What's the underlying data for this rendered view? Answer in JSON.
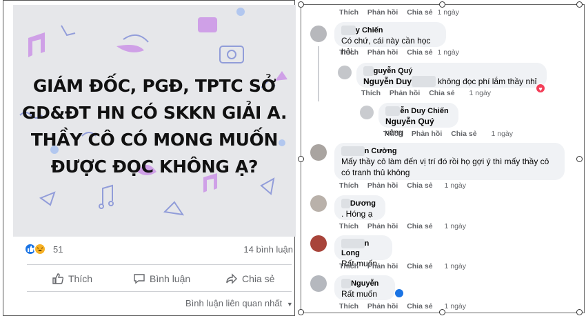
{
  "post": {
    "image_text": [
      "GIÁM ĐỐC, PGĐ, TPTC SỞ",
      "GD&ĐT HN CÓ SKKN GIẢI A.",
      "THẦY CÔ CÓ MONG MUỐN",
      "ĐƯỢC ĐỌC KHÔNG Ạ?"
    ],
    "reaction_count": "51",
    "comment_count": "14 bình luận",
    "actions": {
      "like": "Thích",
      "comment": "Bình luận",
      "share": "Chia sẻ"
    },
    "comment_sort": "Bình luận liên quan nhất"
  },
  "comments": {
    "meta_labels": {
      "like": "Thích",
      "reply": "Phản hồi",
      "share": "Chia sẻ"
    },
    "items": [
      {
        "author": "",
        "text": "",
        "time": "1 ngày"
      },
      {
        "author": "y Chiến",
        "text": "Có chứ, cái này cần học hỏi.",
        "time": "1 ngày"
      },
      {
        "author": "guyễn Quý",
        "tag": "Nguyễn Duy",
        "text": " không đọc phí lắm thầy nhỉ",
        "time": "1 ngày"
      },
      {
        "author": "ễn Duy Chiến",
        "tag": "Nguyễn Quý",
        "text": " vâng",
        "time": "1 ngày"
      },
      {
        "author": "n Cường",
        "text": "Mấy thầy cô làm đến vị trí đó rồi họ gợi ý thì mấy thầy cô có tranh thủ không",
        "time": "1 ngày"
      },
      {
        "author": "Dương",
        "text": ". Hóng ạ",
        "time": "1 ngày"
      },
      {
        "author": "n Long",
        "text": "Rất muốn",
        "time": "1 ngày"
      },
      {
        "author": "Nguyễn",
        "text": "Rất muốn",
        "time": "1 ngày"
      }
    ]
  },
  "colors": {
    "facebook_blue": "#1b74e4",
    "bubble_bg": "#f0f2f5",
    "meta_gray": "#65676b",
    "heart_red": "#f33e58"
  }
}
